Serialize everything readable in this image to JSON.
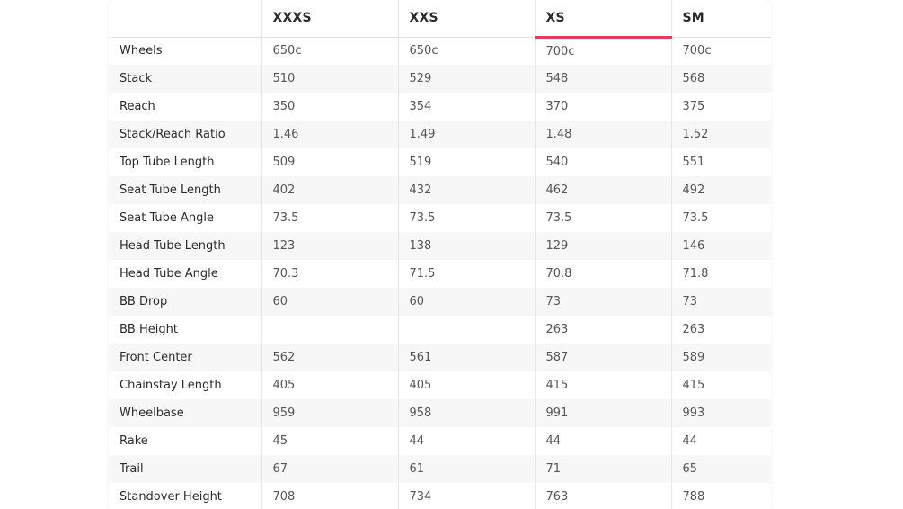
{
  "columns": [
    "",
    "XXXS",
    "XXS",
    "XS",
    "SM"
  ],
  "active_column": "XS",
  "accent_color": "#e8395a",
  "rows": [
    {
      "label": "Wheels",
      "values": [
        "650c",
        "650c",
        "700c",
        "700c"
      ]
    },
    {
      "label": "Stack",
      "values": [
        "510",
        "529",
        "548",
        "568"
      ]
    },
    {
      "label": "Reach",
      "values": [
        "350",
        "354",
        "370",
        "375"
      ]
    },
    {
      "label": "Stack/Reach Ratio",
      "values": [
        "1.46",
        "1.49",
        "1.48",
        "1.52"
      ]
    },
    {
      "label": "Top Tube Length",
      "values": [
        "509",
        "519",
        "540",
        "551"
      ]
    },
    {
      "label": "Seat Tube Length",
      "values": [
        "402",
        "432",
        "462",
        "492"
      ]
    },
    {
      "label": "Seat Tube Angle",
      "values": [
        "73.5",
        "73.5",
        "73.5",
        "73.5"
      ]
    },
    {
      "label": "Head Tube Length",
      "values": [
        "123",
        "138",
        "129",
        "146"
      ]
    },
    {
      "label": "Head Tube Angle",
      "values": [
        "70.3",
        "71.5",
        "70.8",
        "71.8"
      ]
    },
    {
      "label": "BB Drop",
      "values": [
        "60",
        "60",
        "73",
        "73"
      ]
    },
    {
      "label": "BB Height",
      "values": [
        "",
        "",
        "263",
        "263"
      ]
    },
    {
      "label": "Front Center",
      "values": [
        "562",
        "561",
        "587",
        "589"
      ]
    },
    {
      "label": "Chainstay Length",
      "values": [
        "405",
        "405",
        "415",
        "415"
      ]
    },
    {
      "label": "Wheelbase",
      "values": [
        "959",
        "958",
        "991",
        "993"
      ]
    },
    {
      "label": "Rake",
      "values": [
        "45",
        "44",
        "44",
        "44"
      ]
    },
    {
      "label": "Trail",
      "values": [
        "67",
        "61",
        "71",
        "65"
      ]
    },
    {
      "label": "Standover Height",
      "values": [
        "708",
        "734",
        "763",
        "788"
      ]
    }
  ]
}
